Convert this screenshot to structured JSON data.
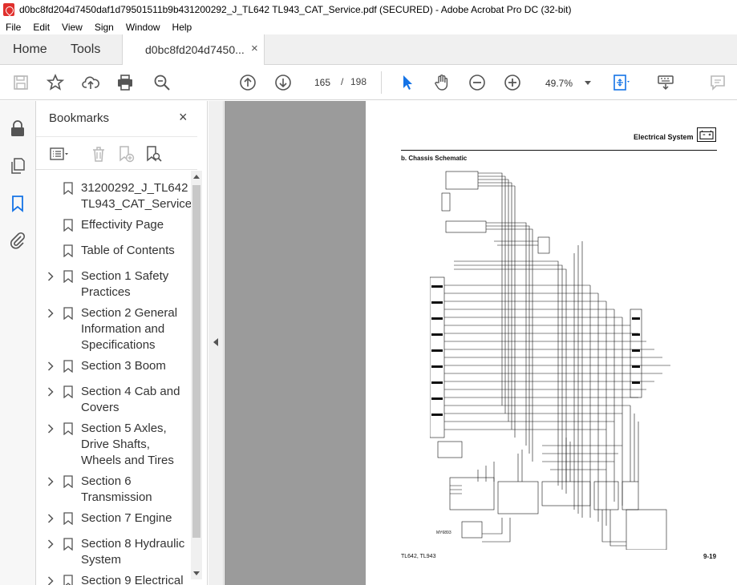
{
  "window": {
    "title": "d0bc8fd204d7450daf1d79501511b9b431200292_J_TL642 TL943_CAT_Service.pdf (SECURED) - Adobe Acrobat Pro DC (32-bit)"
  },
  "menu": [
    "File",
    "Edit",
    "View",
    "Sign",
    "Window",
    "Help"
  ],
  "tabs": {
    "home": "Home",
    "tools": "Tools",
    "document": "d0bc8fd204d7450...",
    "close": "×"
  },
  "toolbar": {
    "current_page": "165",
    "page_separator": "/",
    "total_pages": "198",
    "zoom": "49.7%"
  },
  "bookmarks": {
    "title": "Bookmarks",
    "close": "×",
    "items": [
      {
        "label": "31200292_J_TL642 TL943_CAT_Service",
        "expandable": false
      },
      {
        "label": "Effectivity Page",
        "expandable": false
      },
      {
        "label": "Table of Contents",
        "expandable": false
      },
      {
        "label": "Section 1 Safety Practices",
        "expandable": true
      },
      {
        "label": "Section 2 General Information and Specifications",
        "expandable": true
      },
      {
        "label": "Section 3 Boom",
        "expandable": true
      },
      {
        "label": "Section 4 Cab and Covers",
        "expandable": true
      },
      {
        "label": "Section 5 Axles, Drive Shafts, Wheels and Tires",
        "expandable": true
      },
      {
        "label": "Section 6 Transmission",
        "expandable": true
      },
      {
        "label": "Section 7 Engine",
        "expandable": true
      },
      {
        "label": "Section 8 Hydraulic System",
        "expandable": true
      },
      {
        "label": "Section 9 Electrical",
        "expandable": true
      }
    ]
  },
  "page": {
    "header": "Electrical System",
    "subtitle": "b.   Chassis Schematic",
    "figure_id": "MY6893",
    "footer_left": "TL642, TL943",
    "footer_right": "9-19"
  }
}
